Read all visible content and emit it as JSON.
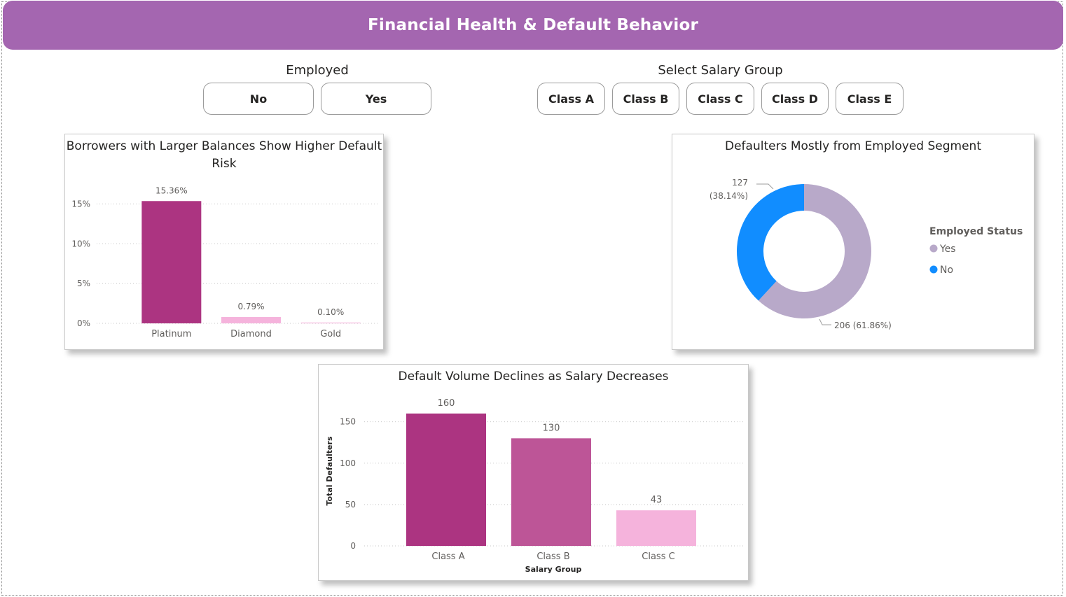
{
  "header": {
    "title": "Financial Health & Default Behavior"
  },
  "slicers": {
    "employed": {
      "title": "Employed",
      "options": [
        "No",
        "Yes"
      ]
    },
    "salary": {
      "title": "Select Salary Group",
      "options": [
        "Class A",
        "Class B",
        "Class C",
        "Class D",
        "Class E"
      ]
    }
  },
  "colors": {
    "header": "#a466b0",
    "bar_dark": "#ac3481",
    "bar_mid": "#bd5597",
    "bar_light": "#f5b3dc",
    "donut_yes": "#b8a9c9",
    "donut_no": "#118dff"
  },
  "charts": {
    "balance": {
      "title": "Borrowers with Larger Balances Show Higher Default Risk",
      "title_lines": [
        "Borrowers with Larger Balances Show Higher Default",
        "Risk"
      ]
    },
    "employed_donut": {
      "title": "Defaulters Mostly from Employed Segment",
      "legend_title": "Employed Status"
    },
    "salary_bar": {
      "title": "Default Volume Declines as Salary Decreases"
    }
  },
  "chart_data": [
    {
      "type": "bar",
      "title": "Borrowers with Larger Balances Show Higher Default Risk",
      "categories": [
        "Platinum",
        "Diamond",
        "Gold"
      ],
      "values": [
        15.36,
        0.79,
        0.1
      ],
      "data_labels": [
        "15.36%",
        "0.79%",
        "0.10%"
      ],
      "ylim": [
        0,
        16
      ],
      "yticks": [
        0,
        5,
        10,
        15
      ],
      "ytick_labels": [
        "0%",
        "5%",
        "10%",
        "15%"
      ],
      "grid": true
    },
    {
      "type": "pie",
      "title": "Defaulters Mostly from Employed Segment",
      "legend_title": "Employed Status",
      "legend_position": "right",
      "labels": [
        "Yes",
        "No"
      ],
      "values": [
        206,
        127
      ],
      "percent_labels": [
        "206 (61.86%)",
        "127 (38.14%)"
      ],
      "colors": [
        "#b8a9c9",
        "#118dff"
      ]
    },
    {
      "type": "bar",
      "title": "Default Volume Declines as Salary Decreases",
      "categories": [
        "Class A",
        "Class B",
        "Class C"
      ],
      "values": [
        160,
        130,
        43
      ],
      "data_labels": [
        "160",
        "130",
        "43"
      ],
      "xlabel": "Salary Group",
      "ylabel": "Total Defaulters",
      "ylim": [
        0,
        170
      ],
      "yticks": [
        0,
        50,
        100,
        150
      ],
      "ytick_labels": [
        "0",
        "50",
        "100",
        "150"
      ],
      "grid": true
    }
  ]
}
